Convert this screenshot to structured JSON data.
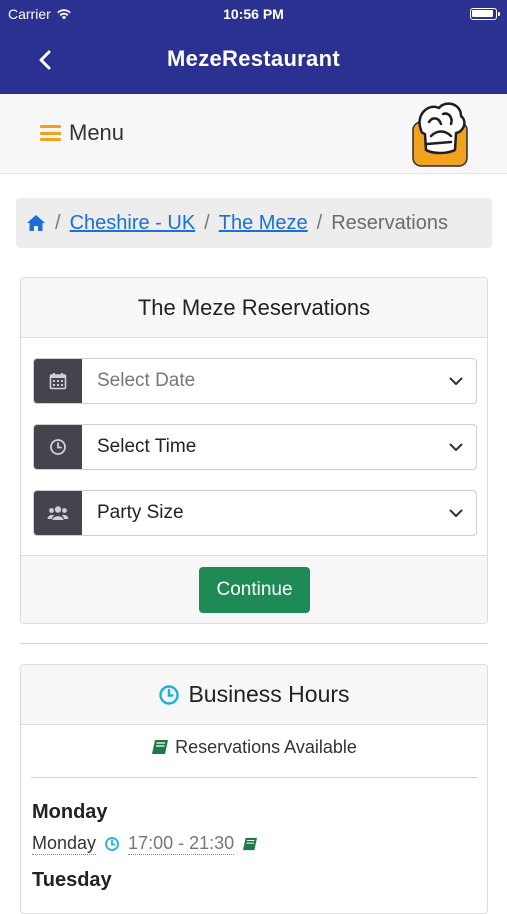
{
  "status_bar": {
    "carrier": "Carrier",
    "time": "10:56 PM"
  },
  "nav": {
    "title": "MezeRestaurant",
    "back_icon": "chevron-left-icon"
  },
  "menu": {
    "label": "Menu",
    "icon": "hamburger-icon",
    "accent": "#f0a21b"
  },
  "breadcrumb": {
    "home_icon": "home-icon",
    "items": [
      "Cheshire - UK",
      "The Meze"
    ],
    "active": "Reservations",
    "separator": "/"
  },
  "reservation": {
    "title": "The Meze Reservations",
    "date_placeholder": "Select Date",
    "time_value": "Select Time",
    "party_value": "Party Size",
    "continue_label": "Continue",
    "button_color": "#1e8a55"
  },
  "hours": {
    "title": "Business Hours",
    "subtitle": "Reservations Available",
    "days": [
      {
        "title": "Monday",
        "label": "Monday",
        "time": "17:00 - 21:30"
      },
      {
        "title": "Tuesday"
      }
    ]
  },
  "colors": {
    "brand": "#2b3191",
    "link": "#1a6fd8",
    "clock": "#1ab3d8"
  }
}
